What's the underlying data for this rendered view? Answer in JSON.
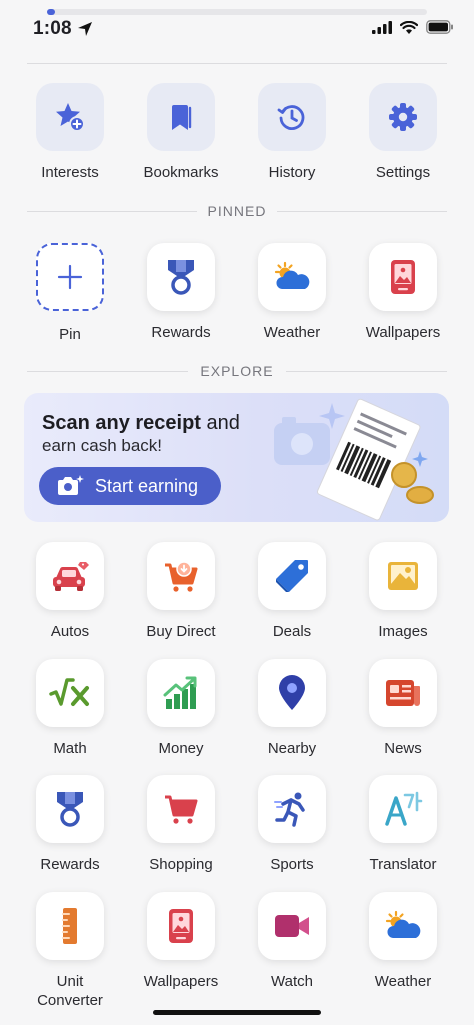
{
  "status": {
    "time": "1:08",
    "load_progress": 0.02
  },
  "quick_actions": [
    {
      "label": "Interests",
      "icon": "star-plus-icon"
    },
    {
      "label": "Bookmarks",
      "icon": "bookmarks-icon"
    },
    {
      "label": "History",
      "icon": "history-icon"
    },
    {
      "label": "Settings",
      "icon": "gear-icon"
    }
  ],
  "pinned": {
    "heading": "PINNED",
    "items": [
      {
        "label": "Pin",
        "icon": "plus-icon"
      },
      {
        "label": "Rewards",
        "icon": "medal-icon"
      },
      {
        "label": "Weather",
        "icon": "sun-cloud-icon"
      },
      {
        "label": "Wallpapers",
        "icon": "wallpaper-phone-icon"
      }
    ]
  },
  "explore": {
    "heading": "EXPLORE",
    "banner": {
      "headline_bold": "Scan any receipt",
      "headline_rest": " and",
      "subline": "earn cash back!",
      "cta": "Start earning"
    },
    "items": [
      {
        "label": "Autos",
        "icon": "car-icon"
      },
      {
        "label": "Buy Direct",
        "icon": "cart-download-icon"
      },
      {
        "label": "Deals",
        "icon": "tag-icon"
      },
      {
        "label": "Images",
        "icon": "image-icon"
      },
      {
        "label": "Math",
        "icon": "math-sqrt-icon"
      },
      {
        "label": "Money",
        "icon": "chart-up-icon"
      },
      {
        "label": "Nearby",
        "icon": "map-pin-icon"
      },
      {
        "label": "News",
        "icon": "newspaper-icon"
      },
      {
        "label": "Rewards",
        "icon": "medal-icon"
      },
      {
        "label": "Shopping",
        "icon": "shopping-cart-icon"
      },
      {
        "label": "Sports",
        "icon": "runner-icon"
      },
      {
        "label": "Translator",
        "icon": "translate-icon"
      },
      {
        "label": "Unit\nConverter",
        "icon": "ruler-icon"
      },
      {
        "label": "Wallpapers",
        "icon": "wallpaper-phone-icon"
      },
      {
        "label": "Watch",
        "icon": "video-camera-icon"
      },
      {
        "label": "Weather",
        "icon": "sun-cloud-icon"
      }
    ]
  },
  "colors": {
    "accent": "#4a63d8",
    "tile_bg_blue": "#e7eaf4",
    "page_bg": "#f6f6f7"
  }
}
